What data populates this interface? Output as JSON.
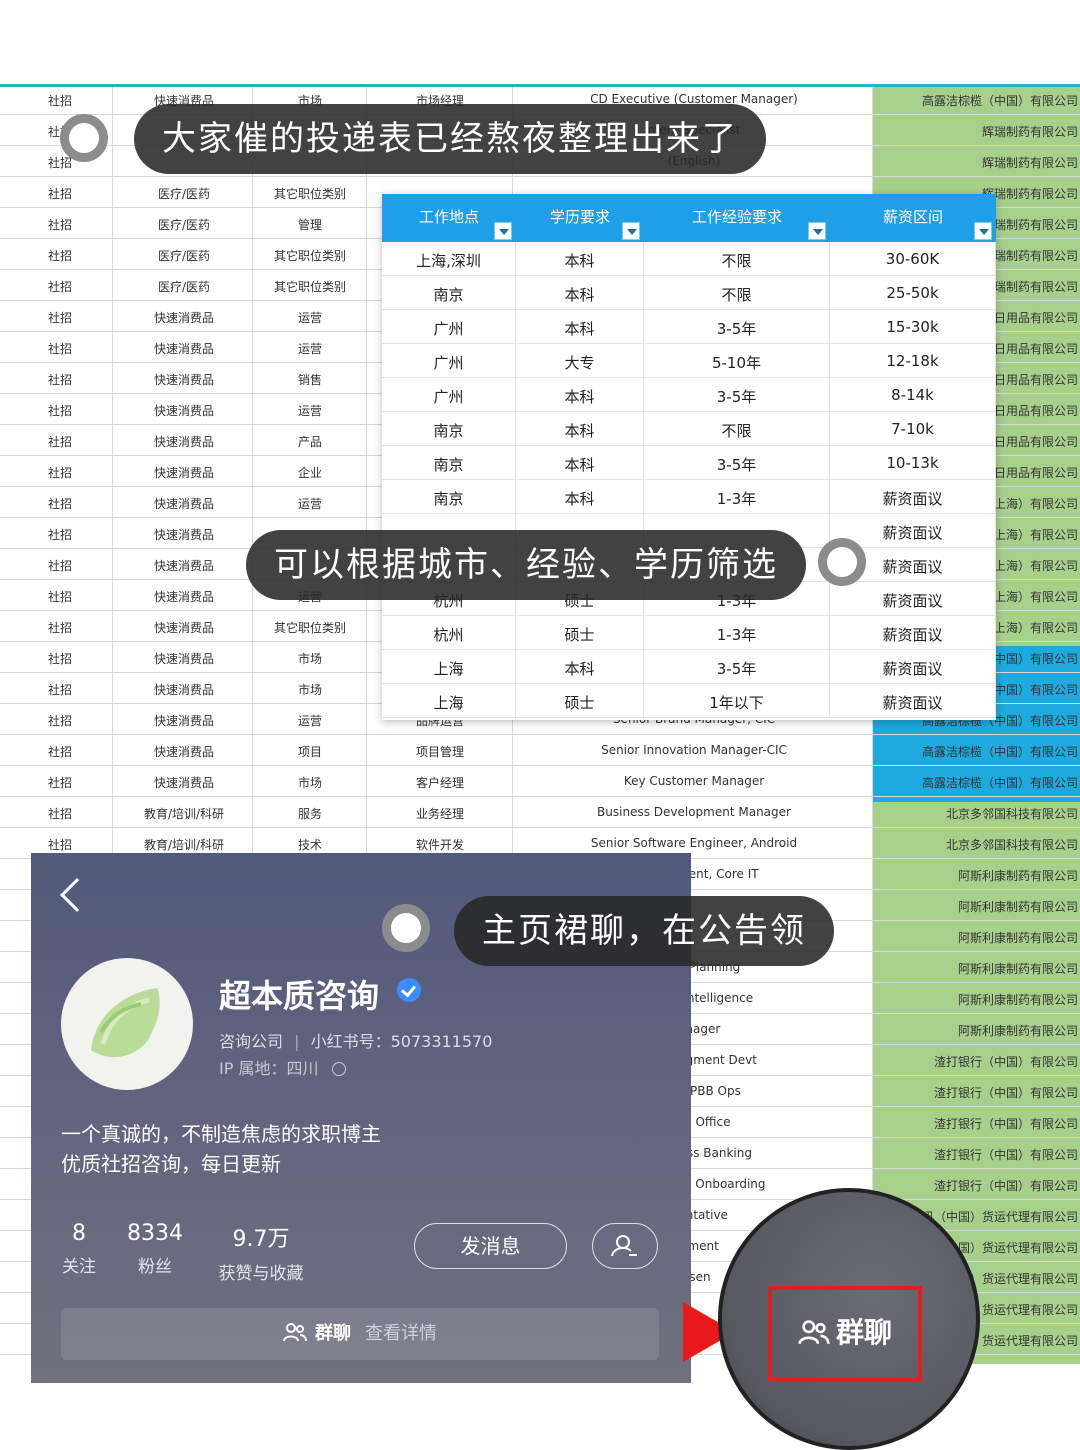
{
  "captions": {
    "top": "大家催的投递表已经熬夜整理出来了",
    "middle": "可以根据城市、经验、学历筛选",
    "bottom": "主页裙聊，在公告领"
  },
  "background_sheet": {
    "rows": [
      [
        "社招",
        "快速消费品",
        "市场",
        "市场经理",
        "CD Executive (Customer Manager)",
        "高露洁棕榄（中国）有限公司"
      ],
      [
        "社招",
        "",
        "",
        "",
        "ment Specialist",
        "辉瑞制药有限公司"
      ],
      [
        "社招",
        "",
        "",
        "",
        "(English)",
        "辉瑞制药有限公司"
      ],
      [
        "社招",
        "医疗/医药",
        "其它职位类别",
        "",
        "",
        "辉瑞制药有限公司"
      ],
      [
        "社招",
        "医疗/医药",
        "管理",
        "",
        "",
        "辉瑞制药有限公司"
      ],
      [
        "社招",
        "医疗/医药",
        "其它职位类别",
        "",
        "",
        "辉瑞制药有限公司"
      ],
      [
        "社招",
        "医疗/医药",
        "其它职位类别",
        "",
        "",
        "辉瑞制药有限公司"
      ],
      [
        "社招",
        "快速消费品",
        "运营",
        "",
        "",
        "日用品有限公司"
      ],
      [
        "社招",
        "快速消费品",
        "运营",
        "",
        "",
        "日用品有限公司"
      ],
      [
        "社招",
        "快速消费品",
        "销售",
        "",
        "",
        "日用品有限公司"
      ],
      [
        "社招",
        "快速消费品",
        "运营",
        "",
        "",
        "日用品有限公司"
      ],
      [
        "社招",
        "快速消费品",
        "产品",
        "",
        "",
        "日用品有限公司"
      ],
      [
        "社招",
        "快速消费品",
        "企业",
        "",
        "",
        "日用品有限公司"
      ],
      [
        "社招",
        "快速消费品",
        "运营",
        "",
        "",
        "上海）有限公司"
      ],
      [
        "社招",
        "快速消费品",
        "",
        "",
        "",
        "上海）有限公司"
      ],
      [
        "社招",
        "快速消费品",
        "",
        "",
        "",
        "上海）有限公司"
      ],
      [
        "社招",
        "快速消费品",
        "运营",
        "",
        "",
        "上海）有限公司"
      ],
      [
        "社招",
        "快速消费品",
        "其它职位类别",
        "",
        "",
        "上海）有限公司"
      ],
      [
        "社招",
        "快速消费品",
        "市场",
        "",
        "",
        "中国）有限公司"
      ],
      [
        "社招",
        "快速消费品",
        "市场",
        "",
        "",
        "中国）有限公司"
      ],
      [
        "社招",
        "快速消费品",
        "运营",
        "品牌运营",
        "Senior Brand Manager, CIC",
        "高露洁棕榄（中国）有限公司"
      ],
      [
        "社招",
        "快速消费品",
        "项目",
        "项目管理",
        "Senior Innovation Manager-CIC",
        "高露洁棕榄（中国）有限公司"
      ],
      [
        "社招",
        "快速消费品",
        "市场",
        "客户经理",
        "Key Customer Manager",
        "高露洁棕榄（中国）有限公司"
      ],
      [
        "社招",
        "教育/培训/科研",
        "服务",
        "业务经理",
        "Business Development Manager",
        "北京多邻国科技有限公司"
      ],
      [
        "社招",
        "教育/培训/科研",
        "技术",
        "软件开发",
        "Senior Software Engineer, Android",
        "北京多邻国科技有限公司"
      ],
      [
        "",
        "",
        "",
        "",
        "Management, Core IT",
        "阿斯利康制药有限公司"
      ],
      [
        "",
        "",
        "",
        "",
        "",
        "阿斯利康制药有限公司"
      ],
      [
        "",
        "",
        "",
        "",
        "",
        "阿斯利康制药有限公司"
      ],
      [
        "",
        "",
        "",
        "",
        "ategic Planning",
        "阿斯利康制药有限公司"
      ],
      [
        "",
        "",
        "",
        "",
        "usiness Intelligence",
        "阿斯利康制药有限公司"
      ],
      [
        "",
        "",
        "",
        "",
        "Manager",
        "阿斯利康制药有限公司"
      ],
      [
        "",
        "",
        "",
        "",
        "Worth Segment Devt",
        "渣打银行（中国）有限公司"
      ],
      [
        "",
        "",
        "",
        "",
        "CDD, CPBB Ops",
        "渣打银行（中国）有限公司"
      ],
      [
        "",
        "",
        "",
        "",
        "r CEO Office",
        "渣打银行（中国）有限公司"
      ],
      [
        "",
        "",
        "",
        "",
        "L Business Banking",
        "渣打银行（中国）有限公司"
      ],
      [
        "",
        "",
        "",
        "",
        "K Mortgage Onboarding",
        "渣打银行（中国）有限公司"
      ],
      [
        "",
        "",
        "",
        "",
        "resentative",
        "迅（中国）货运代理有限公司"
      ],
      [
        "",
        "",
        "",
        "",
        "lopment",
        "（中国）货运代理有限公司"
      ],
      [
        "",
        "",
        "",
        "",
        "resen",
        "（中国）货运代理有限公司"
      ],
      [
        "",
        "",
        "",
        "",
        "",
        "（中国）货运代理有限公司"
      ],
      [
        "",
        "",
        "",
        "",
        "en",
        "（中国）货运代理有限公司"
      ]
    ]
  },
  "filter_table": {
    "headers": [
      "工作地点",
      "学历要求",
      "工作经验要求",
      "薪资区间"
    ],
    "rows": [
      [
        "上海,深圳",
        "本科",
        "不限",
        "30-60K"
      ],
      [
        "南京",
        "本科",
        "不限",
        "25-50k"
      ],
      [
        "广州",
        "本科",
        "3-5年",
        "15-30k"
      ],
      [
        "广州",
        "大专",
        "5-10年",
        "12-18k"
      ],
      [
        "广州",
        "本科",
        "3-5年",
        "8-14k"
      ],
      [
        "南京",
        "本科",
        "不限",
        "7-10k"
      ],
      [
        "南京",
        "本科",
        "3-5年",
        "10-13k"
      ],
      [
        "南京",
        "本科",
        "1-3年",
        "薪资面议"
      ],
      [
        "",
        "",
        "",
        "薪资面议"
      ],
      [
        "",
        "",
        "",
        "薪资面议"
      ],
      [
        "杭州",
        "硕士",
        "1-3年",
        "薪资面议"
      ],
      [
        "杭州",
        "硕士",
        "1-3年",
        "薪资面议"
      ],
      [
        "上海",
        "本科",
        "3-5年",
        "薪资面议"
      ],
      [
        "上海",
        "硕士",
        "1年以下",
        "薪资面议"
      ]
    ]
  },
  "profile": {
    "name": "超本质咨询",
    "category": "咨询公司",
    "id_label": "小红书号：5073311570",
    "ip": "IP 属地：四川",
    "bio_line1": "一个真诚的，不制造焦虑的求职博主",
    "bio_line2": "优质社招咨询，每日更新",
    "stats": [
      {
        "value": "8",
        "label": "关注"
      },
      {
        "value": "8334",
        "label": "粉丝"
      },
      {
        "value": "9.7万",
        "label": "获赞与收藏"
      }
    ],
    "message_button": "发消息",
    "group_label": "群聊",
    "group_detail": "查看详情"
  },
  "zoom_label": "群聊",
  "colors": {
    "header_blue": "#1e9fe8",
    "sheet_green": "#a8d08d",
    "sheet_blue": "#1eaadf",
    "highlight_red": "#e02020"
  }
}
